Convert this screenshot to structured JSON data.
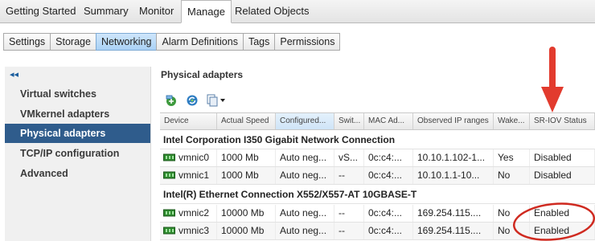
{
  "top_tabs": [
    {
      "label": "Getting Started"
    },
    {
      "label": "Summary"
    },
    {
      "label": "Monitor"
    },
    {
      "label": "Manage"
    },
    {
      "label": "Related Objects"
    }
  ],
  "sub_tabs": [
    {
      "label": "Settings"
    },
    {
      "label": "Storage"
    },
    {
      "label": "Networking"
    },
    {
      "label": "Alarm Definitions"
    },
    {
      "label": "Tags"
    },
    {
      "label": "Permissions"
    }
  ],
  "nav": {
    "collapse_glyph": "◂◂",
    "items": [
      {
        "label": "Virtual switches"
      },
      {
        "label": "VMkernel adapters"
      },
      {
        "label": "Physical adapters"
      },
      {
        "label": "TCP/IP configuration"
      },
      {
        "label": "Advanced"
      }
    ]
  },
  "main": {
    "section_title": "Physical adapters",
    "toolbar_icons": [
      "add-networking-icon",
      "refresh-icon",
      "copy-menu-icon"
    ],
    "columns": [
      "Device",
      "Actual Speed",
      "Configured...",
      "Swit...",
      "MAC Ad...",
      "Observed IP ranges",
      "Wake...",
      "SR-IOV Status"
    ],
    "groups": [
      {
        "name": "Intel Corporation I350 Gigabit Network Connection",
        "rows": [
          [
            "vmnic0",
            "1000 Mb",
            "Auto neg...",
            "vS...",
            "0c:c4:...",
            "10.10.1.102-1...",
            "Yes",
            "Disabled"
          ],
          [
            "vmnic1",
            "1000 Mb",
            "Auto neg...",
            "--",
            "0c:c4:...",
            "10.10.1.1-10...",
            "No",
            "Disabled"
          ]
        ]
      },
      {
        "name": "Intel(R) Ethernet Connection X552/X557-AT 10GBASE-T",
        "rows": [
          [
            "vmnic2",
            "10000 Mb",
            "Auto neg...",
            "--",
            "0c:c4:...",
            "169.254.115....",
            "No",
            "Enabled"
          ],
          [
            "vmnic3",
            "10000 Mb",
            "Auto neg...",
            "--",
            "0c:c4:...",
            "169.254.115....",
            "No",
            "Enabled"
          ]
        ]
      }
    ]
  },
  "colors": {
    "accent": "#2f5c8c",
    "annotation_red": "#e23b2e",
    "sorted_header": "#cfe4f7"
  }
}
